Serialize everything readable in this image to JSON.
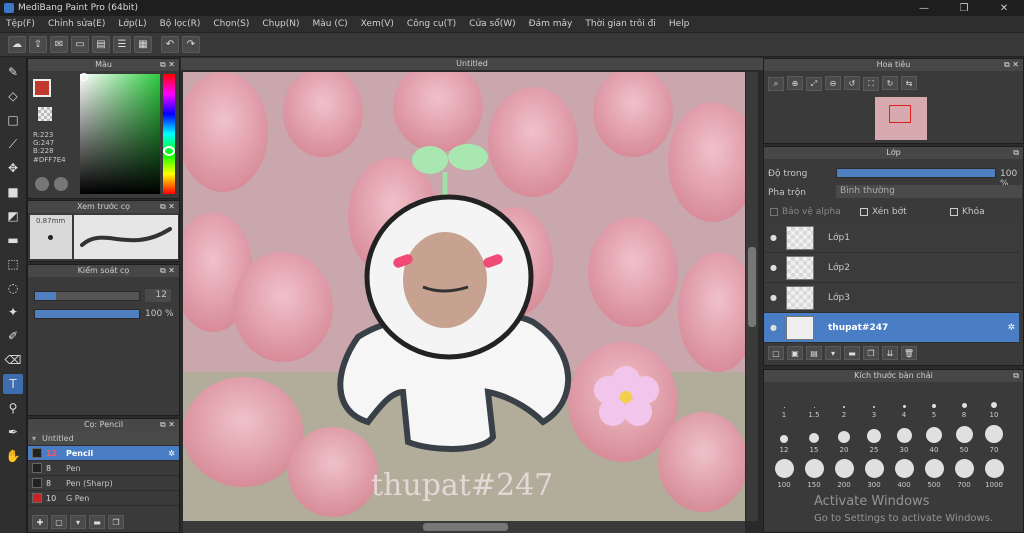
{
  "window": {
    "title": "MediBang Paint Pro (64bit)",
    "controls": [
      "—",
      "❐",
      "✕"
    ]
  },
  "menu": [
    "Tệp(F)",
    "Chỉnh sửa(E)",
    "Lớp(L)",
    "Bộ lọc(R)",
    "Chọn(S)",
    "Chụp(N)",
    "Màu (C)",
    "Xem(V)",
    "Công cụ(T)",
    "Cửa sổ(W)",
    "Đám mây",
    "Thời gian trôi đi",
    "Help"
  ],
  "color_panel": {
    "title": "Màu",
    "r": "R:223",
    "g": "G:247",
    "b": "B:228",
    "hex": "#DFF7E4"
  },
  "brush_preview": {
    "title": "Xem trước cọ",
    "size": "0.87mm"
  },
  "brush_control": {
    "title": "Kiểm soát cọ",
    "size_value": "12",
    "size_fraction": 0.2,
    "opacity_value": "100 %",
    "opacity_fraction": 1.0
  },
  "brush_list": {
    "title": "Cọ: Pencil",
    "group": "Untitled",
    "items": [
      {
        "num": "12",
        "name": "Pencil",
        "color": "#222222",
        "selected": true
      },
      {
        "num": "8",
        "name": "Pen",
        "color": "#222222",
        "selected": false
      },
      {
        "num": "8",
        "name": "Pen (Sharp)",
        "color": "#222222",
        "selected": false
      },
      {
        "num": "10",
        "name": "G Pen",
        "color": "#cc2222",
        "selected": false
      }
    ]
  },
  "canvas": {
    "tab": "Untitled",
    "watermark": "thupat#247"
  },
  "navigator": {
    "title": "Hoa tiêu"
  },
  "layer_panel": {
    "title": "Lớp",
    "opacity_label": "Độ trong",
    "opacity_value": "100 %",
    "opacity_fraction": 1.0,
    "blend_label": "Pha trộn",
    "blend_value": "Bình thường",
    "protect_alpha": "Bảo vệ alpha",
    "clipping": "Xén bớt",
    "lock": "Khóa",
    "layers": [
      {
        "name": "Lớp1",
        "selected": false
      },
      {
        "name": "Lớp2",
        "selected": false
      },
      {
        "name": "Lớp3",
        "selected": false
      },
      {
        "name": "thupat#247",
        "selected": true
      }
    ]
  },
  "brush_size_panel": {
    "title": "Kích thước bàn chải",
    "sizes": [
      "1",
      "1.5",
      "2",
      "3",
      "4",
      "5",
      "8",
      "10",
      "12",
      "15",
      "20",
      "25",
      "30",
      "40",
      "50",
      "70",
      "100",
      "150",
      "200",
      "300",
      "400",
      "500",
      "700",
      "1000"
    ]
  },
  "activation": {
    "line1": "Activate Windows",
    "line2": "Go to Settings to activate Windows."
  },
  "colors": {
    "accent": "#4a7ec4",
    "fg_swatch": "#c0392b"
  }
}
